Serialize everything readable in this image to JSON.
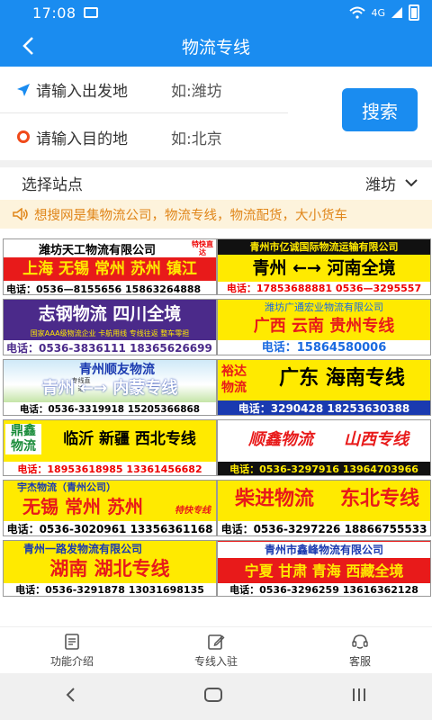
{
  "status": {
    "time": "17:08",
    "signal": "4G"
  },
  "navbar": {
    "title": "物流专线"
  },
  "search": {
    "from_label": "请输入出发地",
    "from_hint": "如:潍坊",
    "to_label": "请输入目的地",
    "to_hint": "如:北京",
    "button": "搜索"
  },
  "station": {
    "label": "选择站点",
    "value": "潍坊"
  },
  "notice": {
    "text": "想搜网是集物流公司，物流专线，物流配货，大小货车"
  },
  "ads": [
    {
      "company": "潍坊天工物流有限公司",
      "badge": "特快直达",
      "routes": "上海 无锡 常州 苏州 镇江",
      "phone": "电话：0536—8155656 15863264888"
    },
    {
      "company": "青州市亿诚国际物流运输有限公司",
      "routes": "青州 ←→ 河南全境",
      "phone": "电话：17853688881 0536—3295557"
    },
    {
      "company": "志钢物流 四川全境",
      "routes": "国家AAA级物流企业 卡航用线 专线往返 整车零担",
      "phone": "电话：0536-3836111 18365626699"
    },
    {
      "company": "潍坊广通宏业物流有限公司",
      "routes": "广西 云南 贵州专线",
      "phone": "电话：15864580006"
    },
    {
      "company": "青州顺友物流",
      "badge": "专线直达",
      "routes": "青州 ←→ 内蒙专线",
      "phone": "电话：0536-3319918 15205366868"
    },
    {
      "company": "裕达物流",
      "routes": "广东 海南专线",
      "phone": "电话：3290428 18253630388"
    },
    {
      "company": "鼎鑫物流",
      "routes": "临沂 新疆 西北专线",
      "phone": "电话：18953618985 13361456682"
    },
    {
      "company": "顺鑫物流",
      "routes": "山西专线",
      "phone": "电话：0536-3297916 13964703966"
    },
    {
      "company": "宇杰物流（青州公司）",
      "routes": "无锡 常州 苏州",
      "badge": "特快专线",
      "phone": "电话：0536-3020961 13356361168"
    },
    {
      "company": "柴进物流",
      "routes": "东北专线",
      "phone": "电话：0536-3297226 18866755533"
    },
    {
      "company": "青州一路发物流有限公司",
      "routes": "湖南 湖北专线",
      "phone": "电话：0536-3291878 13031698135"
    },
    {
      "company": "青州市鑫峰物流有限公司",
      "routes": "宁夏 甘肃 青海 西藏全境",
      "phone": "电话：0536-3296259 13616362128"
    }
  ],
  "tabs": [
    {
      "label": "功能介绍",
      "icon": "document-icon"
    },
    {
      "label": "专线入驻",
      "icon": "edit-icon"
    },
    {
      "label": "客服",
      "icon": "customer-service-icon"
    }
  ],
  "colors": {
    "primary": "#1a8cf0",
    "notice_bg": "#fdf3dc",
    "notice_text": "#e0861a"
  }
}
